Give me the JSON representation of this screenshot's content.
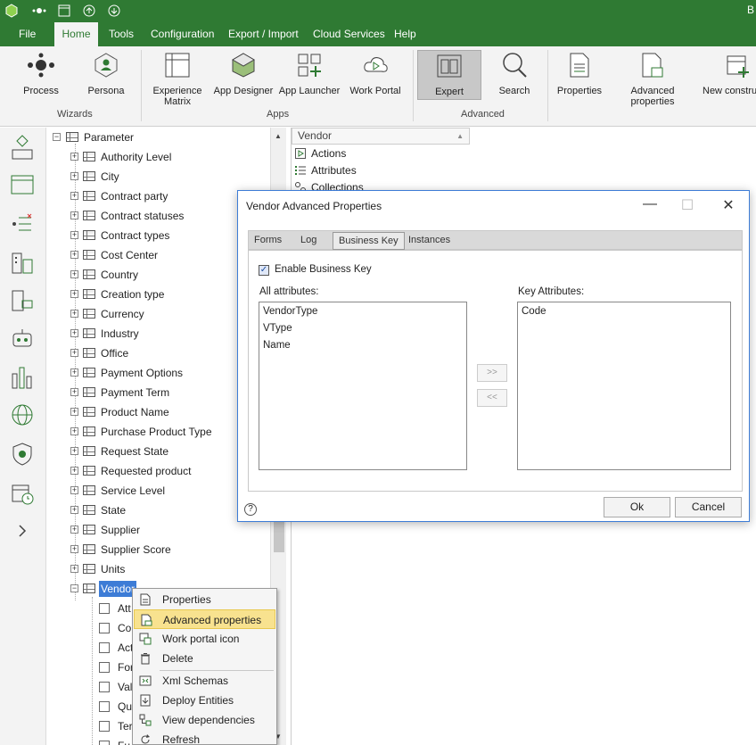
{
  "app": {
    "title_fragment": "B"
  },
  "menu": [
    "File",
    "Home",
    "Tools",
    "Configuration",
    "Export / Import",
    "Cloud Services",
    "Help"
  ],
  "ribbon": {
    "process": "Process",
    "persona": "Persona",
    "experience_matrix_1": "Experience",
    "experience_matrix_2": "Matrix",
    "app_designer": "App Designer",
    "app_launcher": "App Launcher",
    "work_portal": "Work Portal",
    "expert": "Expert",
    "search": "Search",
    "properties": "Properties",
    "advanced_properties": "Advanced properties",
    "new_construct": "New constru",
    "groups": {
      "wizards": "Wizards",
      "apps": "Apps",
      "advanced": "Advanced"
    }
  },
  "tree": {
    "root": "Parameter",
    "items": [
      "Authority Level",
      "City",
      "Contract party",
      "Contract statuses",
      "Contract types",
      "Cost Center",
      "Country",
      "Creation type",
      "Currency",
      "Industry",
      "Office",
      "Payment Options",
      "Payment Term",
      "Product Name",
      "Purchase Product Type",
      "Request State",
      "Requested product",
      "Service Level",
      "State",
      "Supplier",
      "Supplier Score",
      "Units"
    ],
    "selected": "Vendor",
    "children_partial": [
      "Att",
      "Co",
      "Act",
      "For",
      "Val",
      "Qu",
      "Ter",
      "Fu"
    ]
  },
  "right_panel": {
    "header": "Vendor",
    "items": [
      "Actions",
      "Attributes",
      "Collections"
    ]
  },
  "dialog": {
    "title": "Vendor Advanced Properties",
    "tabs": [
      "Forms",
      "Log",
      "Business Key",
      "Instances"
    ],
    "enable_label": "Enable Business Key",
    "enable_checked": true,
    "all_attributes_label": "All attributes:",
    "all_attributes": [
      "VendorType",
      "VType",
      "Name"
    ],
    "key_attributes_label": "Key Attributes:",
    "key_attributes": [
      "Code"
    ],
    "add_btn": ">>",
    "remove_btn": "<<",
    "ok": "Ok",
    "cancel": "Cancel",
    "help": "?"
  },
  "context_menu": [
    "Properties",
    "Advanced properties",
    "Work portal icon",
    "Delete",
    "Xml Schemas",
    "Deploy Entities",
    "View dependencies",
    "Refresh"
  ],
  "colors": {
    "brand_green": "#2f7a33",
    "selection_blue": "#3d7cd6",
    "menu_highlight": "#f8e28f"
  }
}
